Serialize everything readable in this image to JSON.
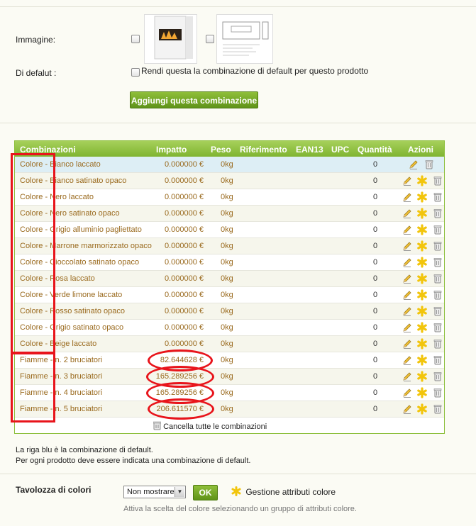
{
  "form": {
    "image_label": "Immagine:",
    "default_label": "Di defalut :",
    "default_checkbox_text": "Rendi questa la combinazione di default per questo prodotto",
    "add_button": "Aggiungi questa combinazione"
  },
  "table": {
    "headers": {
      "combinazioni": "Combinazioni",
      "impatto": "Impatto",
      "peso": "Peso",
      "riferimento": "Riferimento",
      "ean13": "EAN13",
      "upc": "UPC",
      "quantita": "Quantità",
      "azioni": "Azioni"
    },
    "rows": [
      {
        "name": "Colore - Bianco laccato",
        "impact": "0.000000 €",
        "weight": "0kg",
        "qty": "0",
        "default": true
      },
      {
        "name": "Colore - Bianco satinato opaco",
        "impact": "0.000000 €",
        "weight": "0kg",
        "qty": "0",
        "default": false
      },
      {
        "name": "Colore - Nero laccato",
        "impact": "0.000000 €",
        "weight": "0kg",
        "qty": "0",
        "default": false
      },
      {
        "name": "Colore - Nero satinato opaco",
        "impact": "0.000000 €",
        "weight": "0kg",
        "qty": "0",
        "default": false
      },
      {
        "name": "Colore - Grigio alluminio pagliettato",
        "impact": "0.000000 €",
        "weight": "0kg",
        "qty": "0",
        "default": false
      },
      {
        "name": "Colore - Marrone marmorizzato opaco",
        "impact": "0.000000 €",
        "weight": "0kg",
        "qty": "0",
        "default": false
      },
      {
        "name": "Colore - Cioccolato satinato opaco",
        "impact": "0.000000 €",
        "weight": "0kg",
        "qty": "0",
        "default": false
      },
      {
        "name": "Colore - Rosa laccato",
        "impact": "0.000000 €",
        "weight": "0kg",
        "qty": "0",
        "default": false
      },
      {
        "name": "Colore - Verde limone laccato",
        "impact": "0.000000 €",
        "weight": "0kg",
        "qty": "0",
        "default": false
      },
      {
        "name": "Colore - Rosso satinato opaco",
        "impact": "0.000000 €",
        "weight": "0kg",
        "qty": "0",
        "default": false
      },
      {
        "name": "Colore - Grigio satinato opaco",
        "impact": "0.000000 €",
        "weight": "0kg",
        "qty": "0",
        "default": false
      },
      {
        "name": "Colore - Beige laccato",
        "impact": "0.000000 €",
        "weight": "0kg",
        "qty": "0",
        "default": false
      },
      {
        "name": "Fiamme - n. 2 bruciatori",
        "impact": "82.644628 €",
        "weight": "0kg",
        "qty": "0",
        "default": false
      },
      {
        "name": "Fiamme - n. 3 bruciatori",
        "impact": "165.289256 €",
        "weight": "0kg",
        "qty": "0",
        "default": false
      },
      {
        "name": "Fiamme - n. 4 bruciatori",
        "impact": "165.289256 €",
        "weight": "0kg",
        "qty": "0",
        "default": false
      },
      {
        "name": "Fiamme - n. 5 bruciatori",
        "impact": "206.611570 €",
        "weight": "0kg",
        "qty": "0",
        "default": false
      }
    ],
    "delete_all": "Cancella tutte le combinazioni"
  },
  "notes": {
    "line1": "La riga blu è la combinazione di default.",
    "line2": "Per ogni prodotto deve essere indicata una combinazione di default."
  },
  "palette": {
    "label": "Tavolozza di colori",
    "select_value": "Non mostrare",
    "ok_button": "OK",
    "manage_link": "Gestione attributi colore",
    "help": "Attiva la scelta del colore selezionando un gruppo di attributi colore."
  },
  "colors": {
    "header_green": "#8cbf3c",
    "default_row_blue": "#ddeef5",
    "link_brown": "#9a6a1e",
    "annotation_red": "#e8141b"
  },
  "icons": {
    "edit": "pencil-icon",
    "set_default": "asterisk-star-icon",
    "delete": "trash-icon"
  }
}
